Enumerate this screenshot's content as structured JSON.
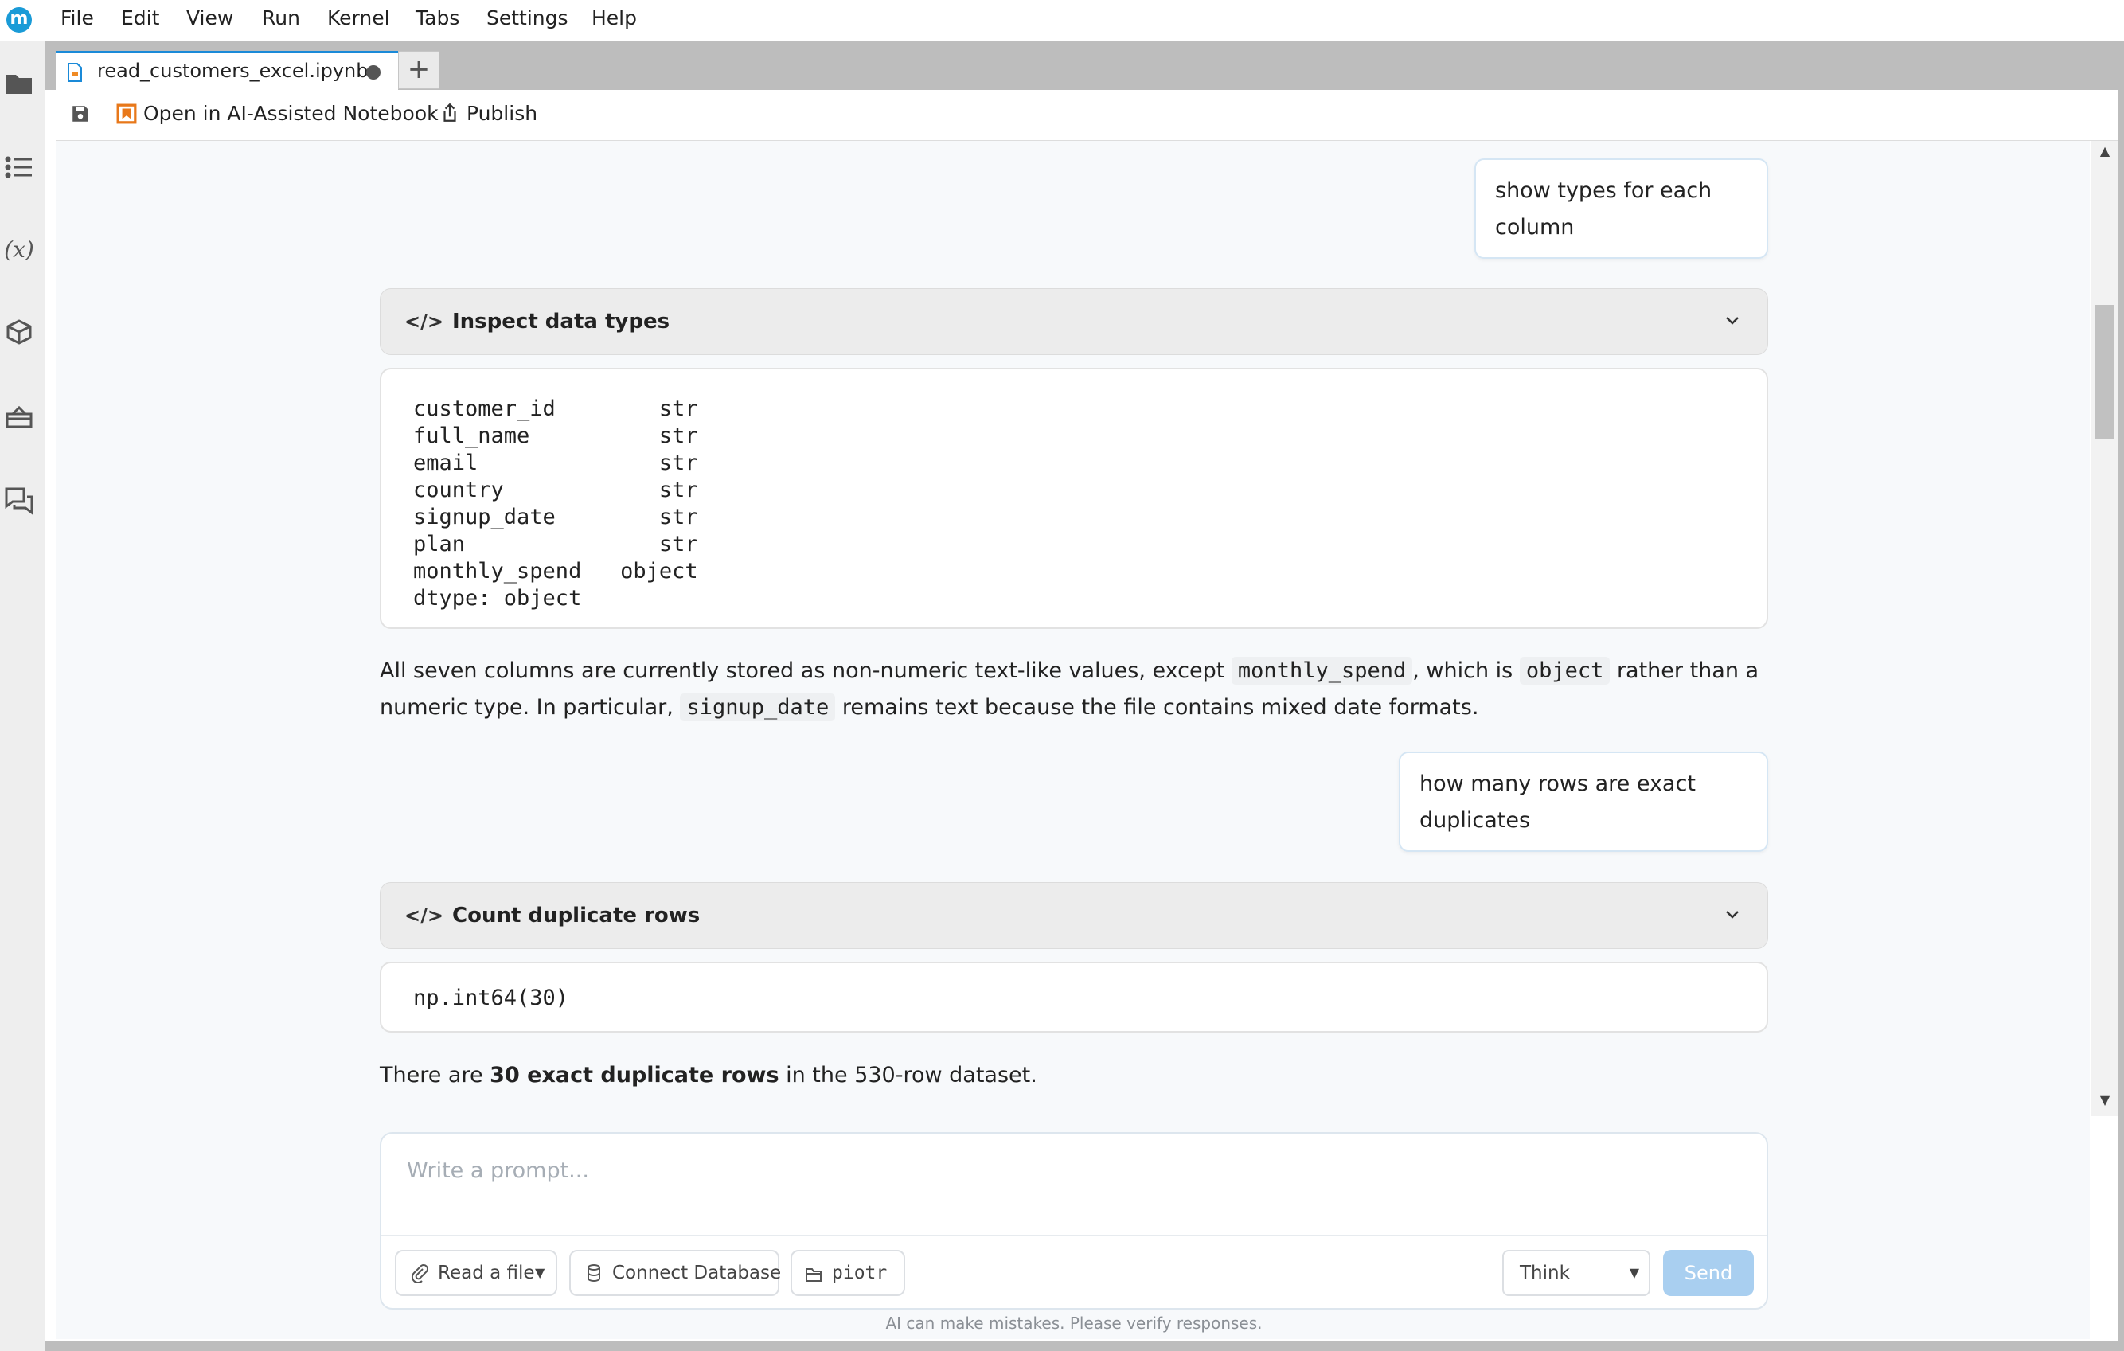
{
  "app": {
    "logo_letter": "m"
  },
  "menubar": {
    "items": [
      "File",
      "Edit",
      "View",
      "Run",
      "Kernel",
      "Tabs",
      "Settings",
      "Help"
    ]
  },
  "tab": {
    "label": "read_customers_excel.ipynb",
    "new_tab_label": "+"
  },
  "toolbar": {
    "open_ai_label": "Open in AI-Assisted Notebook",
    "publish_label": "Publish"
  },
  "chat": {
    "msg1": {
      "text": "show types for each column"
    },
    "cell1": {
      "title": "Inspect data types",
      "icon": "</>",
      "output": "customer_id        str\nfull_name          str\nemail              str\ncountry            str\nsignup_date        str\nplan               str\nmonthly_spend   object\ndtype: object"
    },
    "answer1": {
      "p1": "All seven columns are currently stored as non-numeric text-like values, except ",
      "code1": "monthly_spend",
      "p2": ", which is ",
      "code2": "object",
      "p3": " rather than a numeric type. In particular, ",
      "code3": "signup_date",
      "p4": " remains text because the file contains mixed date formats."
    },
    "msg2": {
      "text": "how many rows are exact duplicates"
    },
    "cell2": {
      "title": "Count duplicate rows",
      "icon": "</>",
      "output": "np.int64(30)"
    },
    "answer2": {
      "p1": "There are ",
      "bold": "30 exact duplicate rows",
      "p2": " in the 530-row dataset."
    }
  },
  "prompt": {
    "placeholder": "Write a prompt...",
    "read_file_label": "Read a file",
    "connect_db_label": "Connect Database",
    "folder_label": "piotr",
    "mode_label": "Think",
    "send_label": "Send",
    "disclaimer": "AI can make mistakes. Please verify responses."
  },
  "colors": {
    "accent": "#1a8ad8",
    "send_disabled": "#a9cff0",
    "logo": "#1a9bd7"
  }
}
